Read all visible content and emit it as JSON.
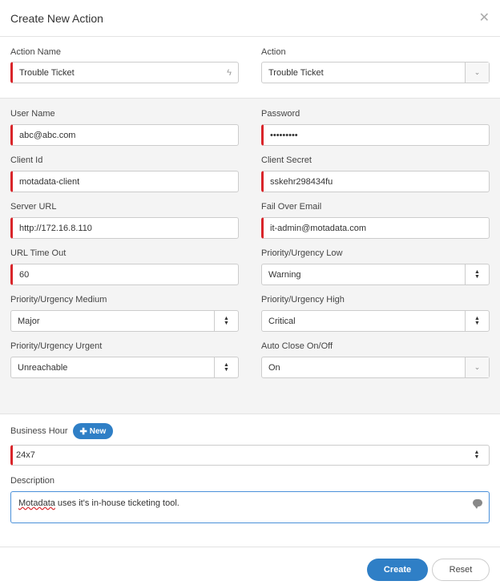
{
  "dialog": {
    "title": "Create New Action",
    "close_icon": "close-icon"
  },
  "fields": {
    "action_name": {
      "label": "Action Name",
      "value": "Trouble Ticket",
      "icon": "bolt-icon"
    },
    "action": {
      "label": "Action",
      "value": "Trouble Ticket"
    },
    "user_name": {
      "label": "User Name",
      "value": "abc@abc.com"
    },
    "password": {
      "label": "Password",
      "value": "•••••••••"
    },
    "client_id": {
      "label": "Client Id",
      "value": "motadata-client"
    },
    "client_secret": {
      "label": "Client Secret",
      "value": "sskehr298434fu"
    },
    "server_url": {
      "label": "Server URL",
      "value": "http://172.16.8.110"
    },
    "fail_over_email": {
      "label": "Fail Over Email",
      "value": "it-admin@motadata.com"
    },
    "url_time_out": {
      "label": "URL Time Out",
      "value": "60"
    },
    "priority_low": {
      "label": "Priority/Urgency Low",
      "value": "Warning"
    },
    "priority_medium": {
      "label": "Priority/Urgency Medium",
      "value": "Major"
    },
    "priority_high": {
      "label": "Priority/Urgency High",
      "value": "Critical"
    },
    "priority_urgent": {
      "label": "Priority/Urgency Urgent",
      "value": "Unreachable"
    },
    "auto_close": {
      "label": "Auto Close On/Off",
      "value": "On"
    },
    "business_hour": {
      "label": "Business Hour",
      "value": "24x7",
      "new_label": "New"
    },
    "description": {
      "label": "Description",
      "misspelled": "Motadata",
      "value_rest": " uses it's in-house ticketing tool."
    }
  },
  "footer": {
    "create_label": "Create",
    "reset_label": "Reset"
  },
  "colors": {
    "accent": "#2f7fc6",
    "required": "#d9252a"
  }
}
